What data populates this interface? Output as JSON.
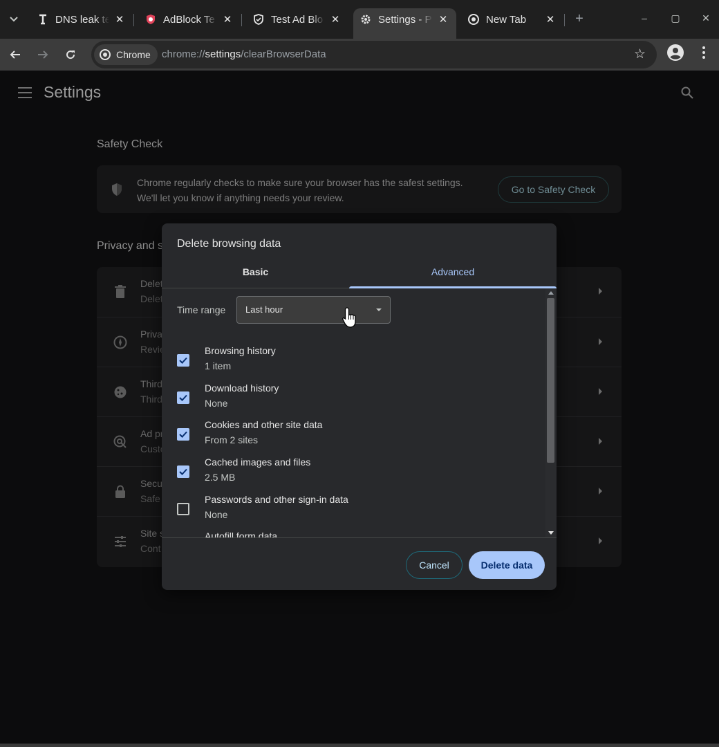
{
  "tabs": [
    {
      "title": "DNS leak te",
      "icon": "dns-leak-favicon-icon",
      "active": false
    },
    {
      "title": "AdBlock Te",
      "icon": "adblock-shield-favicon-icon",
      "active": false
    },
    {
      "title": "Test Ad Blo",
      "icon": "shield-favicon-icon",
      "active": false
    },
    {
      "title": "Settings - P",
      "icon": "gear-favicon-icon",
      "active": true
    },
    {
      "title": "New Tab",
      "icon": "chrome-favicon-icon",
      "active": false
    }
  ],
  "window_controls": {
    "minimize": "–",
    "maximize": "▢",
    "close": "✕"
  },
  "toolbar": {
    "chip_label": "Chrome",
    "url_prefix": "chrome://",
    "url_host": "settings",
    "url_path": "/clearBrowserData"
  },
  "settings": {
    "title": "Settings",
    "safety_check": {
      "heading": "Safety Check",
      "line1": "Chrome regularly checks to make sure your browser has the safest settings.",
      "line2": "We'll let you know if anything needs your review.",
      "button": "Go to Safety Check"
    },
    "privacy": {
      "heading": "Privacy and s",
      "rows": [
        {
          "t1": "Delet",
          "t2": "Delet",
          "icon": "trash-icon"
        },
        {
          "t1": "Priva",
          "t2": "Revie",
          "icon": "compass-icon"
        },
        {
          "t1": "Third",
          "t2": "Third",
          "icon": "cookie-icon"
        },
        {
          "t1": "Ad pr",
          "t2": "Custo",
          "icon": "ad-privacy-icon"
        },
        {
          "t1": "Secu",
          "t2": "Safe",
          "icon": "lock-icon"
        },
        {
          "t1": "Site s",
          "t2": "Cont",
          "icon": "sliders-icon"
        }
      ]
    }
  },
  "dialog": {
    "title": "Delete browsing data",
    "tabs": {
      "basic": "Basic",
      "advanced": "Advanced"
    },
    "time_range_label": "Time range",
    "time_range_value": "Last hour",
    "options": [
      {
        "label": "Browsing history",
        "detail": "1 item",
        "checked": true
      },
      {
        "label": "Download history",
        "detail": "None",
        "checked": true
      },
      {
        "label": "Cookies and other site data",
        "detail": "From 2 sites",
        "checked": true
      },
      {
        "label": "Cached images and files",
        "detail": "2.5 MB",
        "checked": true
      },
      {
        "label": "Passwords and other sign-in data",
        "detail": "None",
        "checked": false
      },
      {
        "label": "Autofill form data",
        "detail": "",
        "checked": false
      }
    ],
    "cancel": "Cancel",
    "delete": "Delete data"
  },
  "colors": {
    "accent": "#a8c7fa",
    "dialog_bg": "#28292c"
  }
}
